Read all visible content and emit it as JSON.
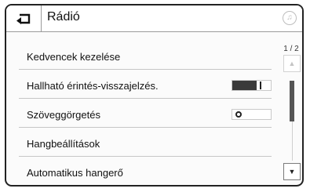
{
  "header": {
    "title": "Rádió",
    "back_icon": "back-arrow-icon",
    "media_icon": "music-note-icon",
    "media_glyph": "♫"
  },
  "menu": {
    "items": [
      {
        "label": "Kedvencek kezelése",
        "control": "none"
      },
      {
        "label": "Hallható érintés-visszajelzés.",
        "control": "toggle",
        "state": "on"
      },
      {
        "label": "Szöveggörgetés",
        "control": "toggle",
        "state": "off"
      },
      {
        "label": "Hangbeállítások",
        "control": "none"
      },
      {
        "label": "Automatikus hangerő",
        "control": "none"
      }
    ]
  },
  "pager": {
    "text": "1 / 2"
  },
  "scroll": {
    "up_glyph": "▲",
    "down_glyph": "▼"
  },
  "colors": {
    "border": "#222222",
    "divider": "#c6c6c6",
    "toggle_on": "#3a3a3a"
  }
}
